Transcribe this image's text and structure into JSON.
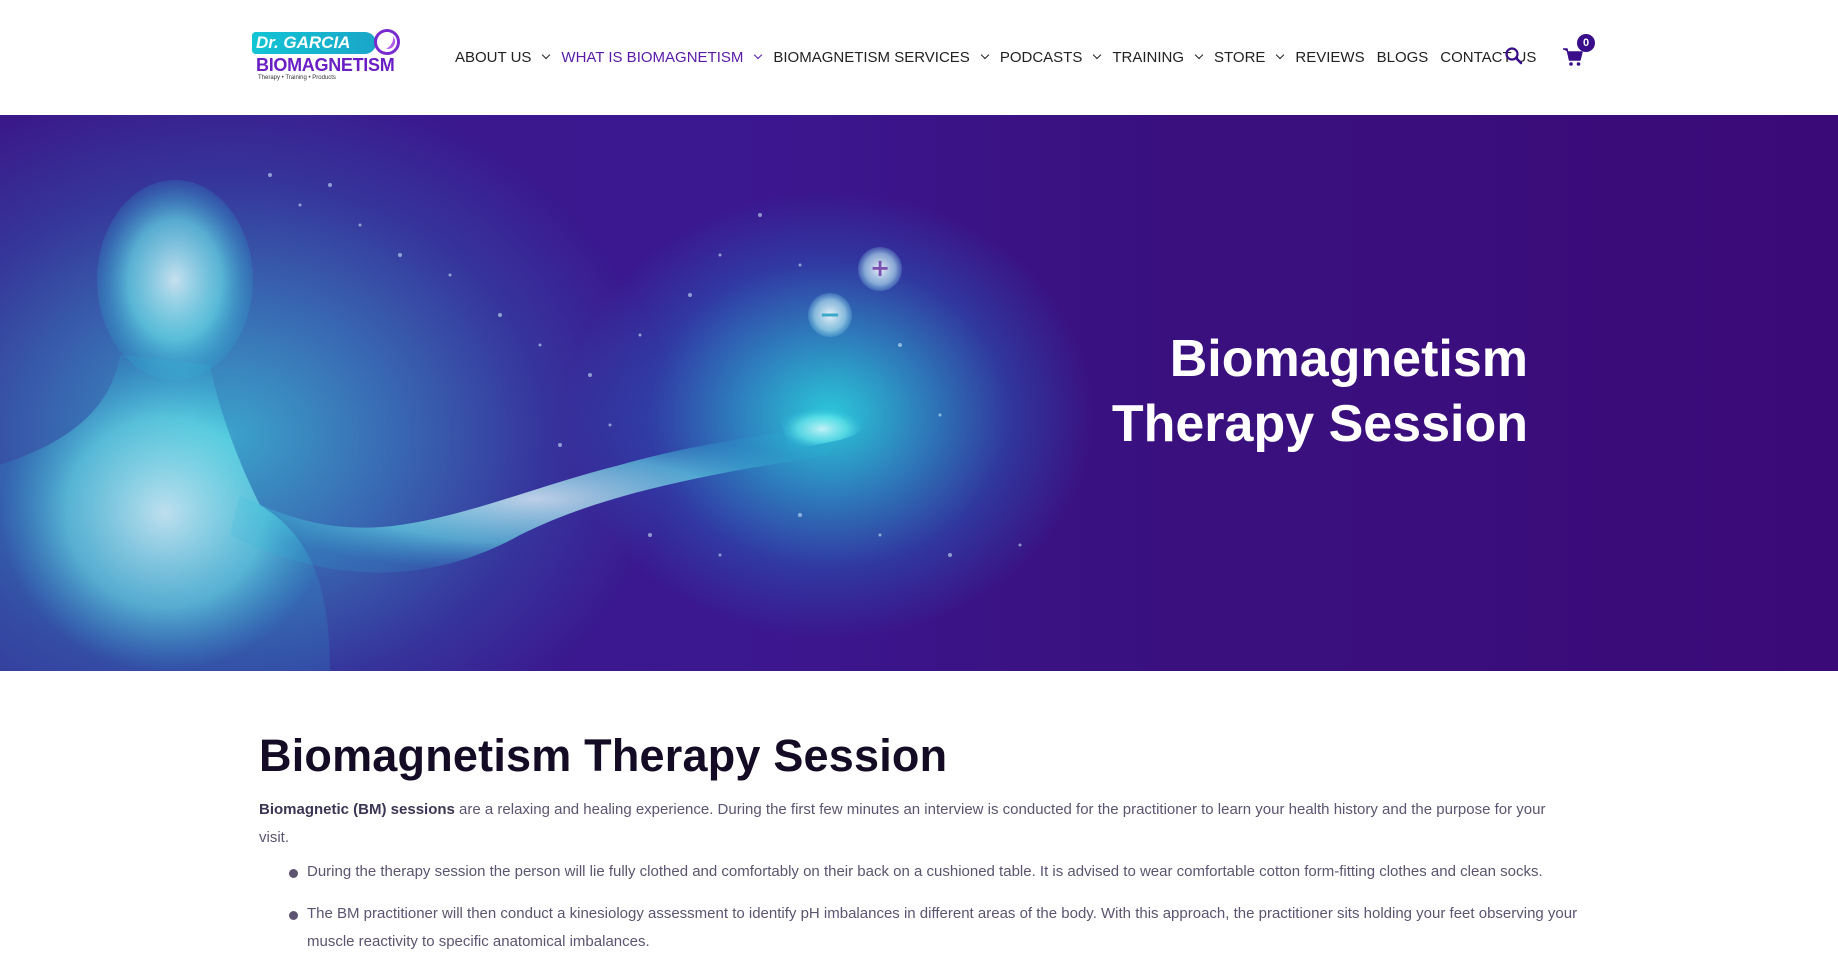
{
  "header": {
    "logo": {
      "top_text": "Dr. GARCIA",
      "main_text": "BIOMAGNETISM",
      "tagline": "Therapy • Training • Products"
    },
    "nav": [
      {
        "label": "ABOUT US",
        "has_dropdown": true,
        "active": false
      },
      {
        "label": "WHAT IS BIOMAGNETISM",
        "has_dropdown": true,
        "active": true
      },
      {
        "label": "BIOMAGNETISM SERVICES",
        "has_dropdown": true,
        "active": false
      },
      {
        "label": "PODCASTS",
        "has_dropdown": true,
        "active": false
      },
      {
        "label": "TRAINING",
        "has_dropdown": true,
        "active": false
      },
      {
        "label": "STORE",
        "has_dropdown": true,
        "active": false
      },
      {
        "label": "REVIEWS",
        "has_dropdown": false,
        "active": false
      },
      {
        "label": "BLOGS",
        "has_dropdown": false,
        "active": false
      },
      {
        "label": "CONTACT US",
        "has_dropdown": false,
        "active": false
      }
    ],
    "search_icon": "search-icon",
    "cart_icon": "cart-icon",
    "cart_count": "0"
  },
  "hero": {
    "title_line1": "Biomagnetism",
    "title_line2": "Therapy Session",
    "plus_symbol": "+",
    "minus_symbol": "−"
  },
  "content": {
    "title": "Biomagnetism Therapy Session",
    "intro_bold": "Biomagnetic (BM) sessions",
    "intro_rest": " are a relaxing and healing experience. During the first few minutes an interview is conducted for the practitioner to learn your health history and the purpose for your visit.",
    "bullets": [
      "During the therapy session the person will lie fully clothed and comfortably on their back on a cushioned table. It is advised to wear comfortable cotton form-fitting clothes and clean socks.",
      "The BM practitioner will then conduct a kinesiology assessment to identify pH imbalances in different areas of the body. With this approach, the practitioner sits holding your feet observing your muscle reactivity to specific anatomical imbalances."
    ]
  },
  "colors": {
    "brand_purple": "#5a1aa8",
    "brand_cyan": "#13c4d4",
    "hero_bg": "#3a0a78",
    "cart_badge": "#3a0d8a"
  }
}
